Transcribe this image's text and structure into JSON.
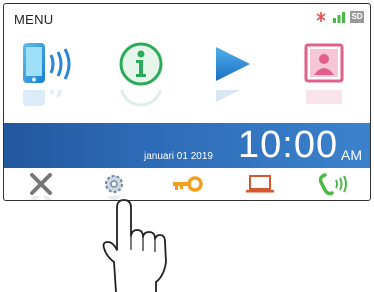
{
  "header": {
    "menu_label": "MENU",
    "sd_label": "SD"
  },
  "top_icons": [
    "phone-wireless-icon",
    "info-icon",
    "play-icon",
    "intercom-door-icon"
  ],
  "bottom_icons": [
    "close-icon",
    "settings-gear-icon",
    "key-icon",
    "laptop-icon",
    "handset-icon"
  ],
  "clock": {
    "date": "januari 01 2019",
    "time": "10:00",
    "ampm": "AM"
  },
  "colors": {
    "band": "#2d69b4",
    "info_green": "#2bab5a",
    "play_blue": "#2f8fd6",
    "accent_pink": "#e0608a",
    "key_orange": "#f0a020"
  }
}
